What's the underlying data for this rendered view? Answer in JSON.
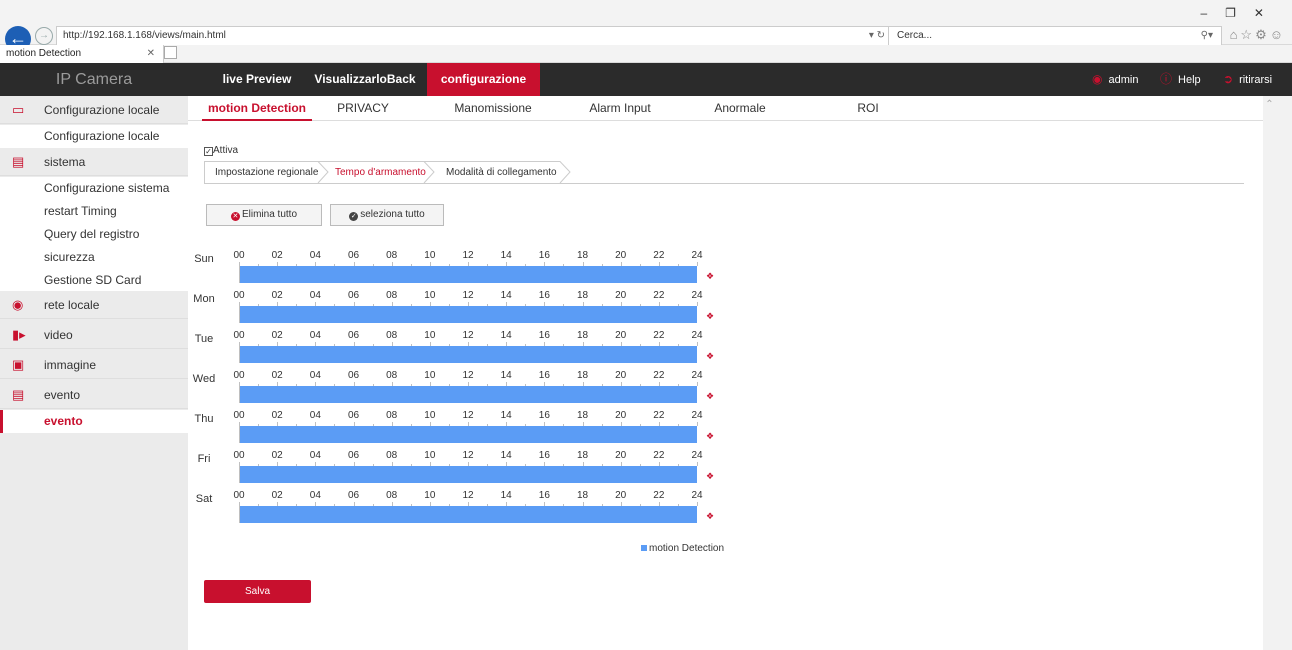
{
  "browser": {
    "url": "http://192.168.1.168/views/main.html",
    "search_placeholder": "Cerca...",
    "tab_title": "motion Detection"
  },
  "topnav": {
    "brand": "IP Camera",
    "items": [
      "live Preview",
      "VisualizzarloBack",
      "configurazione"
    ],
    "active": "configurazione",
    "user": "admin",
    "help": "Help",
    "logout": "ritirarsi"
  },
  "sidebar": {
    "groups": [
      {
        "label": "Configurazione locale",
        "icon": "monitor-icon",
        "subs": [
          "Configurazione locale"
        ]
      },
      {
        "label": "sistema",
        "icon": "window-icon",
        "subs": [
          "Configurazione sistema",
          "restart Timing",
          "Query del registro",
          "sicurezza",
          "Gestione SD Card"
        ]
      },
      {
        "label": "rete locale",
        "icon": "globe-icon",
        "subs": []
      },
      {
        "label": "video",
        "icon": "video-icon",
        "subs": []
      },
      {
        "label": "immagine",
        "icon": "image-icon",
        "subs": []
      },
      {
        "label": "evento",
        "icon": "event-icon",
        "subs": [
          "evento"
        ]
      }
    ],
    "active_sub": "evento"
  },
  "subtabs": [
    "motion Detection",
    "PRIVACY",
    "Manomissione",
    "Alarm Input",
    "Anormale",
    "ROI"
  ],
  "enable_label": "Attiva",
  "steps": [
    "Impostazione regionale",
    "Tempo d'armamento",
    "Modalità di collegamento"
  ],
  "buttons": {
    "delete_all": "Elimina tutto",
    "select_all": "seleziona tutto",
    "save": "Salva"
  },
  "schedule": {
    "hours": [
      "00",
      "02",
      "04",
      "06",
      "08",
      "10",
      "12",
      "14",
      "16",
      "18",
      "20",
      "22",
      "24"
    ],
    "days": [
      "Sun",
      "Mon",
      "Tue",
      "Wed",
      "Thu",
      "Fri",
      "Sat"
    ],
    "legend": "motion Detection",
    "bar_color": "#5b9cf5"
  },
  "colors": {
    "accent": "#c8102e",
    "nav_bg": "#2b2b2b"
  }
}
